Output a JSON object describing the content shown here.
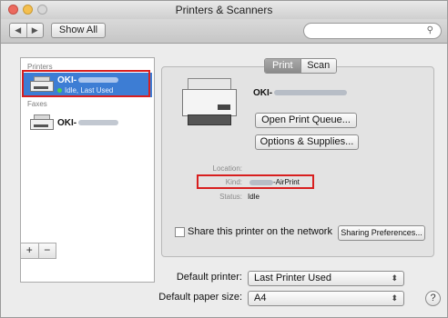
{
  "window": {
    "title": "Printers & Scanners"
  },
  "toolbar": {
    "back_icon": "back-arrow-icon",
    "forward_icon": "forward-arrow-icon",
    "show_all_label": "Show All",
    "search_placeholder": ""
  },
  "sidebar": {
    "printers_header": "Printers",
    "faxes_header": "Faxes",
    "selected_printer": {
      "name": "OKI-",
      "status": "Idle, Last Used"
    },
    "fax_item": {
      "name": "OKI-"
    },
    "add_label": "+",
    "remove_label": "−"
  },
  "tabs": {
    "print_label": "Print",
    "scan_label": "Scan"
  },
  "detail": {
    "printer_name": "OKI-",
    "open_queue_label": "Open Print Queue...",
    "options_label": "Options & Supplies...",
    "location_label": "Location:",
    "location_value": "",
    "kind_label": "Kind:",
    "kind_value": "-AirPrint",
    "status_label": "Status:",
    "status_value": "Idle",
    "share_label": "Share this printer on the network",
    "share_checked": false,
    "sharing_prefs_label": "Sharing Preferences..."
  },
  "bottom": {
    "default_printer_label": "Default printer:",
    "default_printer_value": "Last Printer Used",
    "default_paper_label": "Default paper size:",
    "default_paper_value": "A4",
    "help_label": "?"
  },
  "colors": {
    "selection": "#3d7dd4",
    "highlight_outline": "#d81f1f"
  }
}
